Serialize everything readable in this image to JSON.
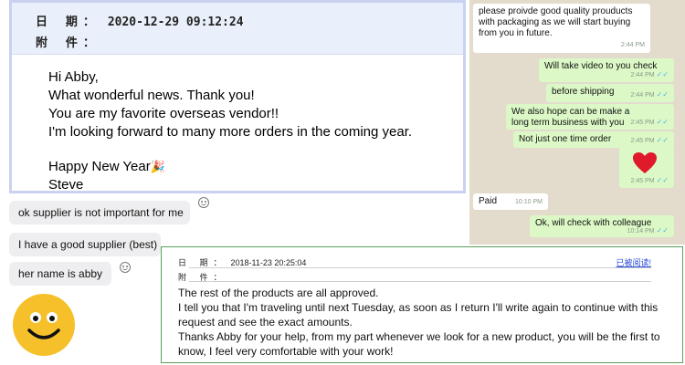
{
  "email1": {
    "date_label": "日 期：",
    "date_value": "2020-12-29 09:12:24",
    "attach_label": "附 件：",
    "lines": [
      "Hi Abby,",
      "What wonderful news. Thank you!",
      "You are my favorite overseas vendor!!",
      "I'm looking forward to many more orders in the coming year."
    ],
    "closing": "Happy New Year",
    "closing_icon": "party-popper-icon",
    "signature": "Steve"
  },
  "whatsapp": {
    "background": "#e3dccd",
    "incoming_color": "#ffffff",
    "outgoing_color": "#dcf8c6",
    "messages": [
      {
        "dir": "in",
        "text": "please proivde good quality prouducts with packaging as we will start buying from you in future.",
        "time": "2:44 PM"
      },
      {
        "dir": "out",
        "text": "Will take video to you check",
        "time": "2:44 PM"
      },
      {
        "dir": "out",
        "text": "before shipping",
        "time": "2:44 PM"
      },
      {
        "dir": "out",
        "text": "We also hope can be make a long term business with you",
        "time": "2:45 PM"
      },
      {
        "dir": "out",
        "text": "Not just one time order",
        "time": "2:45 PM"
      },
      {
        "dir": "out",
        "text": "",
        "icon": "heart-icon",
        "time": "2:45 PM"
      },
      {
        "dir": "in",
        "text": "Paid",
        "time": "10:10 PM"
      },
      {
        "dir": "out",
        "text": "Ok, will check with colleague",
        "time": "10:14 PM"
      }
    ]
  },
  "chat": {
    "messages": [
      "ok supplier is not important for me",
      "I have a good supplier (best)",
      "her name is abby"
    ]
  },
  "email2": {
    "date_label": "日 期：",
    "date_value": "2018-11-23 20:25:04",
    "attach_label": "附 件：",
    "read_link": "已被阅读!",
    "lines": [
      "The rest of the products are all approved.",
      "I tell you that I'm traveling until next Tuesday, as soon as I return I'll write again to continue with this request and see the exact amounts.",
      "Thanks Abby for your help, from my part whenever we look for a new product, you will be the first to know, I feel very comfortable with your work!"
    ]
  }
}
